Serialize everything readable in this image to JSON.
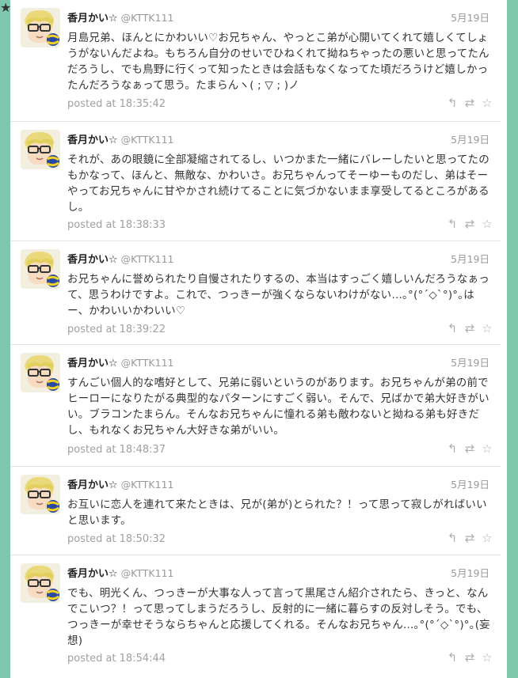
{
  "icons": {
    "reply": "reply-icon",
    "retweet": "retweet-icon",
    "favorite": "star-icon",
    "edge": "star-icon"
  },
  "colors": {
    "background": "#7fc7ad",
    "card": "#ffffff",
    "meta": "#a0a0a0"
  },
  "tweets": [
    {
      "name": "香月かい☆",
      "handle": "@KTTK111",
      "date": "5月19日",
      "text": "月島兄弟、ほんとにかわいい♡お兄ちゃん、やっとこ弟が心開いてくれて嬉しくてしょうがないんだよね。もちろん自分のせいでひねくれて拗ねちゃったの悪いと思ってたんだろうし、でも鳥野に行くって知ったときは会話もなくなってた頃だろうけど嬉しかったんだろうなぁって思う。たまらんヽ( ; ▽ ; )ノ",
      "posted": "posted at 18:35:42"
    },
    {
      "name": "香月かい☆",
      "handle": "@KTTK111",
      "date": "5月19日",
      "text": "それが、あの眼鏡に全部凝縮されてるし、いつかまた一緒にバレーしたいと思ってたのもかなって、ほんと、無敵な、かわいさ。お兄ちゃんってそーゆーものだし、弟はそーやってお兄ちゃんに甘やかされ続けてることに気づかないまま享受してるところがあるし。",
      "posted": "posted at 18:38:33"
    },
    {
      "name": "香月かい☆",
      "handle": "@KTTK111",
      "date": "5月19日",
      "text": "お兄ちゃんに誉められたり自慢されたりするの、本当はすっごく嬉しいんだろうなぁって、思うわけですよ。これで、つっきーが強くならないわけがない…｡°(°´◇`°)°｡はー、かわいいかわいい♡",
      "posted": "posted at 18:39:22"
    },
    {
      "name": "香月かい☆",
      "handle": "@KTTK111",
      "date": "5月19日",
      "text": "すんごい個人的な嗜好として、兄弟に弱いというのがあります。お兄ちゃんが弟の前でヒーローになりたがる典型的なパターンにすごく弱い。そんで、兄ばかで弟大好きがいい。ブラコンたまらん。そんなお兄ちゃんに憧れる弟も敵わないと拗ねる弟も好きだし、もれなくお兄ちゃん大好きな弟がいい。",
      "posted": "posted at 18:48:37"
    },
    {
      "name": "香月かい☆",
      "handle": "@KTTK111",
      "date": "5月19日",
      "text": "お互いに恋人を連れて来たときは、兄が(弟が)とられた？！って思って寂しがればいいと思います。",
      "posted": "posted at 18:50:32"
    },
    {
      "name": "香月かい☆",
      "handle": "@KTTK111",
      "date": "5月19日",
      "text": "でも、明光くん、つっきーが大事な人って言って黒尾さん紹介されたら、きっと、なんでこいつ？！って思ってしまうだろうし、反射的に一緒に暮らすの反対しそう。でも、つっきーが幸せそうならちゃんと応援してくれる。そんなお兄ちゃん…｡°(°´◇`°)°｡(妄想)",
      "posted": "posted at 18:54:44"
    }
  ]
}
